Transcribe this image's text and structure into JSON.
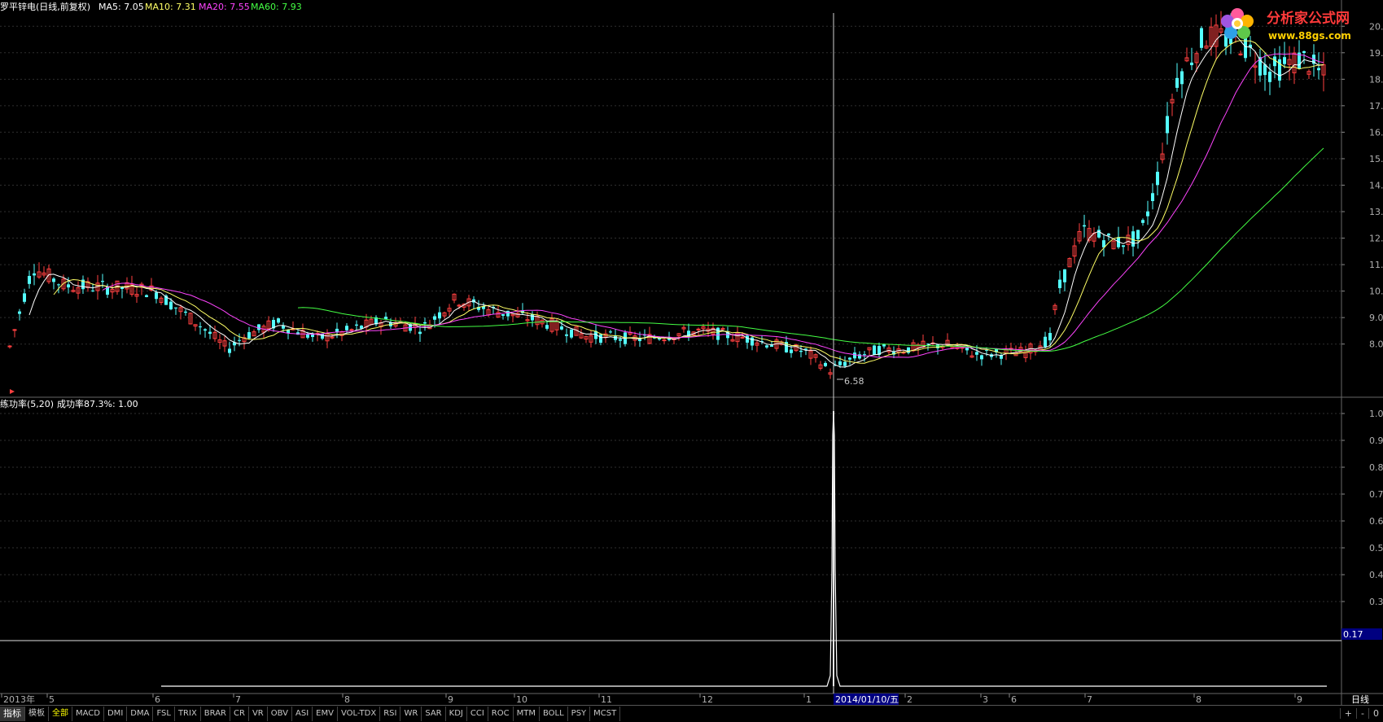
{
  "header": {
    "stock_title": "罗平锌电(日线,前复权)",
    "ma5": "MA5: 7.05",
    "ma10": "MA10: 7.31",
    "ma20": "MA20: 7.55",
    "ma60": "MA60: 7.93"
  },
  "colors": {
    "background": "#000000",
    "up": "#ff4040",
    "down": "#54ffff",
    "ma5": "#ffffff",
    "ma10": "#ffff66",
    "ma20": "#ff44ff",
    "ma60": "#44ff44",
    "grid": "#2a2a2a",
    "highlight": "#000080"
  },
  "price_axis": [
    "20.00",
    "19.00",
    "18.00",
    "17.00",
    "16.00",
    "15.00",
    "14.00",
    "13.00",
    "12.00",
    "11.00",
    "10.00",
    "9.00",
    "8.00"
  ],
  "low_label": "6.58",
  "indicator": {
    "title": "练功率(5,20)",
    "value_label": "成功率87.3%: 1.00",
    "axis": [
      "1.00",
      "0.90",
      "0.80",
      "0.70",
      "0.60",
      "0.50",
      "0.40",
      "0.30"
    ],
    "current_value": "0.17"
  },
  "date_axis": {
    "labels": [
      "2013年",
      "5",
      "6",
      "7",
      "8",
      "9",
      "10",
      "11",
      "12",
      "1",
      "2",
      "3",
      "6",
      "7",
      "8",
      "9"
    ],
    "cursor_date": "2014/01/10/五",
    "period": "日线"
  },
  "logo": {
    "name": "分析家公式网",
    "url": "www.88gs.com"
  },
  "tabs": [
    "指标",
    "模板",
    "全部",
    "MACD",
    "DMI",
    "DMA",
    "FSL",
    "TRIX",
    "BRAR",
    "CR",
    "VR",
    "OBV",
    "ASI",
    "EMV",
    "VOL-TDX",
    "RSI",
    "WR",
    "SAR",
    "KDJ",
    "CCI",
    "ROC",
    "MTM",
    "BOLL",
    "PSY",
    "MCST"
  ],
  "controls": [
    "+",
    "-",
    "0"
  ]
}
